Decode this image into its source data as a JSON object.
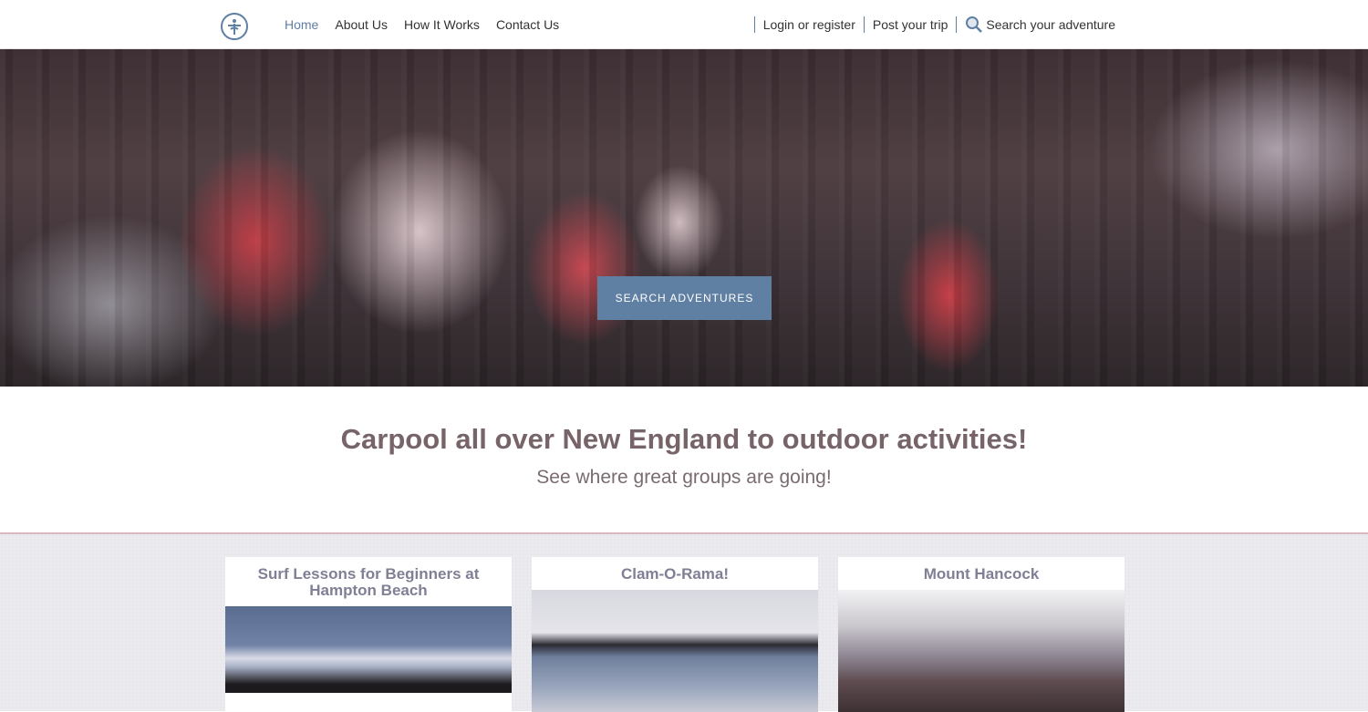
{
  "nav": {
    "items": [
      {
        "label": "Home",
        "active": true
      },
      {
        "label": "About Us"
      },
      {
        "label": "How It Works"
      },
      {
        "label": "Contact Us"
      }
    ],
    "login": "Login or register",
    "post_trip": "Post your trip",
    "search": "Search your adventure"
  },
  "hero": {
    "button": "SEARCH ADVENTURES"
  },
  "intro": {
    "title": "Carpool all over New England to outdoor activities!",
    "subtitle": "See where great groups are going!"
  },
  "cards": [
    {
      "title": "Surf Lessons for Beginners at Hampton Beach"
    },
    {
      "title": "Clam-O-Rama!"
    },
    {
      "title": "Mount Hancock"
    }
  ],
  "colors": {
    "accent": "#5f7fa3",
    "heading": "#776468",
    "card_title": "#7f7f95"
  }
}
